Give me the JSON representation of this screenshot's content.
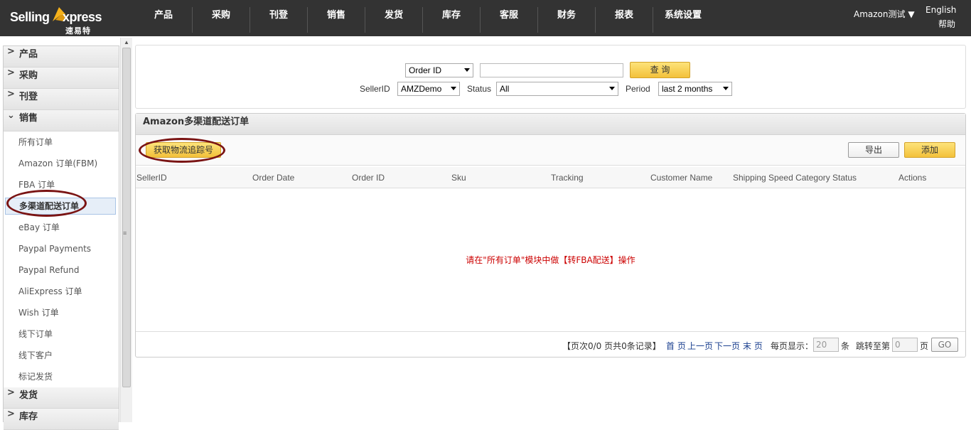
{
  "brand": {
    "name_part1": "Selling",
    "name_part2": "xpress",
    "subtitle": "速易特",
    "accent": "#f6b21b"
  },
  "nav": {
    "items": [
      "产品",
      "采购",
      "刊登",
      "销售",
      "发货",
      "库存",
      "客服",
      "财务",
      "报表",
      "系统设置"
    ]
  },
  "account": {
    "label": "Amazon测试 ▼",
    "language": "English",
    "help": "帮助"
  },
  "sidebar": {
    "sections_top": [
      "产品",
      "采购",
      "刊登"
    ],
    "open_section": "销售",
    "items": [
      "所有订单",
      "Amazon 订单(FBM)",
      "FBA 订单",
      "多渠道配送订单",
      "eBay 订单",
      "Paypal Payments",
      "Paypal Refund",
      "AliExpress 订单",
      "Wish 订单",
      "线下订单",
      "线下客户",
      "标记发货"
    ],
    "active_index": 3,
    "sections_bottom": [
      "发货",
      "库存"
    ]
  },
  "search": {
    "field_select": "Order ID",
    "query_value": "",
    "search_button": "查 询",
    "seller_label": "SellerID",
    "seller_value": "AMZDemo",
    "status_label": "Status",
    "status_value": "All",
    "period_label": "Period",
    "period_value": "last 2 months"
  },
  "orders": {
    "title": "Amazon多渠道配送订单",
    "tracking_button": "获取物流追踪号",
    "export_button": "导出",
    "add_button": "添加",
    "columns": [
      "SellerID",
      "Order Date",
      "Order ID",
      "Sku",
      "Tracking",
      "Customer Name",
      "Shipping Speed Category",
      "Status",
      "Actions"
    ],
    "empty_message": "请在\"所有订单\"模块中做【转FBA配送】操作"
  },
  "pager": {
    "summary": "【页次0/0   页共0条记录】",
    "first": "首 页",
    "prev": "上一页",
    "next": "下一页",
    "last": "末 页",
    "per_page_label": "每页显示：",
    "per_page_value": "20",
    "unit": "条",
    "jump_label": "跳转至第",
    "jump_value": "0",
    "page_unit": "页",
    "go": "GO"
  }
}
